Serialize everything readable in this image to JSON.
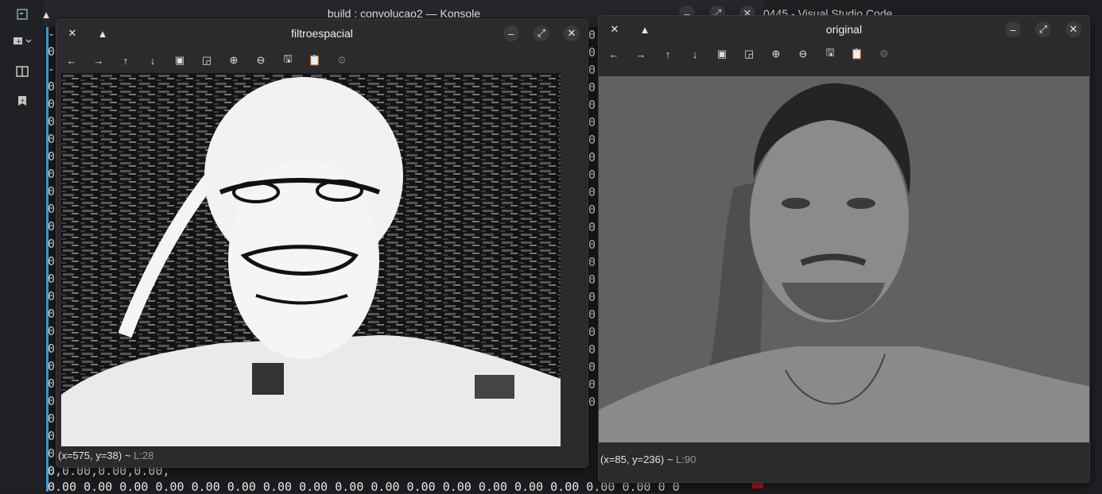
{
  "vscode": {
    "title_fragment": "0445 - Visual Studio Code",
    "activity_icons": [
      "explorer-app-icon",
      "remote-add-icon",
      "split-editor-icon",
      "bookmark-add-icon"
    ]
  },
  "konsole": {
    "title": "build : convolucao2 — Konsole",
    "left_col": [
      "-",
      "0",
      "-",
      "0",
      "0",
      "0",
      "0",
      "0",
      "0",
      "0",
      "0",
      "0",
      "0",
      "0",
      "0",
      "0",
      "0",
      "0",
      "0",
      "0",
      "0",
      "0",
      "0",
      "0",
      "0",
      "0"
    ],
    "right_col": [
      "0",
      "0",
      "0",
      "0",
      "0",
      "0",
      "0",
      "0",
      "0",
      "0",
      "0",
      "0",
      "0",
      "0",
      "0",
      "0",
      "0",
      "0",
      "0",
      "0",
      "0",
      "0"
    ],
    "bottom_line_1": "0,0.00,0.00,0.00,",
    "bottom_line_2": "0.00 0.00 0.00 0.00 0.00 0.00 0.00 0.00 0.00 0.00 0.00 0.00 0.00 0.00 0.00 0.00 0.00 0 0"
  },
  "windows": [
    {
      "id": "filtroespacial",
      "title": "filtroespacial",
      "status_coords": "(x=575, y=38) ~",
      "status_level": "L:28",
      "image_desc": "filtered"
    },
    {
      "id": "original",
      "title": "original",
      "status_coords": "(x=85, y=236) ~",
      "status_level": "L:90",
      "image_desc": "original"
    }
  ],
  "toolbar": [
    {
      "name": "pan-left-icon",
      "glyph": "←"
    },
    {
      "name": "pan-right-icon",
      "glyph": "→"
    },
    {
      "name": "pan-up-icon",
      "glyph": "↑"
    },
    {
      "name": "pan-down-icon",
      "glyph": "↓"
    },
    {
      "name": "zoom-fit-icon",
      "glyph": "▣"
    },
    {
      "name": "zoom-original-icon",
      "glyph": "◲"
    },
    {
      "name": "zoom-in-icon",
      "glyph": "⊕"
    },
    {
      "name": "zoom-out-icon",
      "glyph": "⊖"
    },
    {
      "name": "save-icon",
      "glyph": "🖫"
    },
    {
      "name": "copy-clipboard-icon",
      "glyph": "📋"
    },
    {
      "name": "properties-icon",
      "glyph": "⚙"
    }
  ]
}
